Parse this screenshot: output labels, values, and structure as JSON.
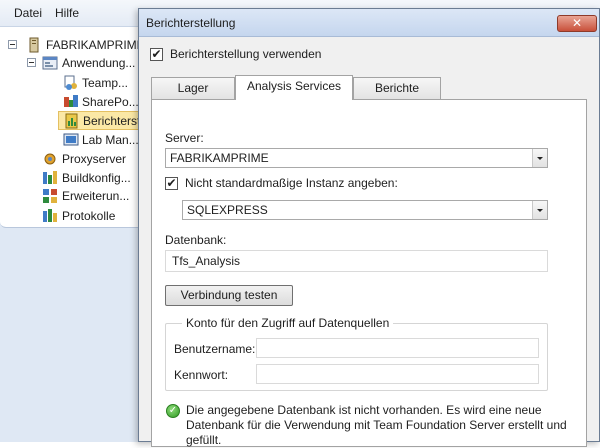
{
  "menu": {
    "items": [
      "Datei",
      "Hilfe"
    ]
  },
  "tree": {
    "items": [
      {
        "label": "FABRIKAMPRIME",
        "icon": "server-icon"
      },
      {
        "label": "Anwendung...",
        "icon": "application-tier-icon"
      },
      {
        "label": "Teamp...",
        "icon": "team-project-icon"
      },
      {
        "label": "SharePo...",
        "icon": "sharepoint-icon"
      },
      {
        "label": "Berichterst",
        "icon": "reporting-icon"
      },
      {
        "label": "Lab Man...",
        "icon": "lab-management-icon"
      },
      {
        "label": "Proxyserver",
        "icon": "proxy-icon"
      },
      {
        "label": "Buildkonfig...",
        "icon": "build-icon"
      },
      {
        "label": "Erweiterun...",
        "icon": "extensions-icon"
      },
      {
        "label": "Protokolle",
        "icon": "logs-icon"
      }
    ]
  },
  "dialog": {
    "title": "Berichterstellung",
    "close_glyph": "✕",
    "use_reporting_label": "Berichterstellung verwenden",
    "use_reporting_checked": "✔",
    "tabs": [
      "Lager",
      "Analysis Services",
      "Berichte"
    ],
    "server_label": "Server:",
    "server_value": "FABRIKAMPRIME",
    "nondefault_label": "Nicht standardmaßige Instanz angeben:",
    "nondefault_checked": "✔",
    "instance_value": "SQLEXPRESS",
    "database_label": "Datenbank:",
    "database_value": "Tfs_Analysis",
    "test_button": "Verbindung testen",
    "account_group": "Konto für den Zugriff auf Datenquellen",
    "username_label": "Benutzername:",
    "username_value": "",
    "password_label": "Kennwort:",
    "password_value": "",
    "info_message": "Die angegebene Datenbank ist nicht vorhanden. Es wird eine neue Datenbank für die Verwendung mit Team Foundation Server erstellt und gefüllt."
  },
  "colors": {
    "selected_item": "#fbe8a6",
    "titlebar": "#c5d6ee",
    "close_button": "#c8503a"
  }
}
